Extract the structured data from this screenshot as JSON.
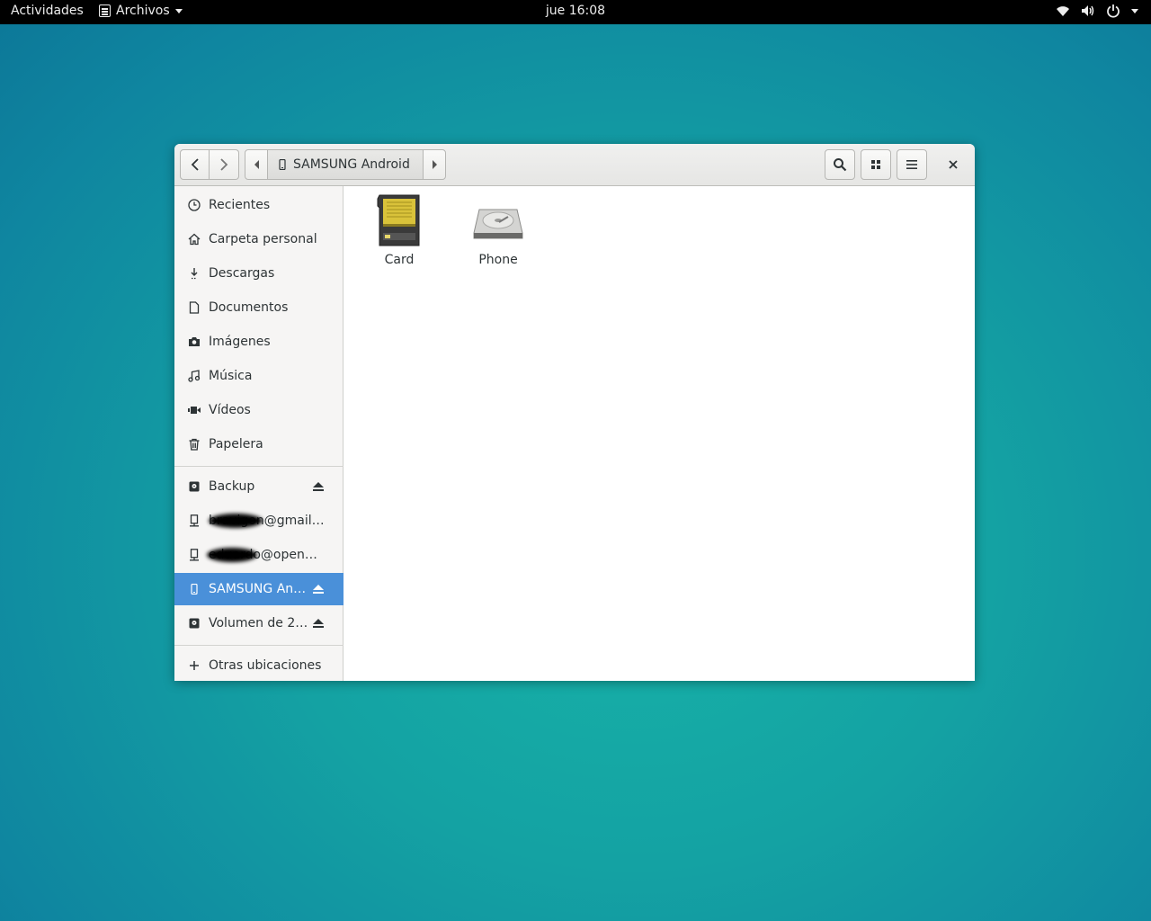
{
  "topbar": {
    "activities": "Actividades",
    "app_name": "Archivos",
    "clock": "jue 16:08"
  },
  "window": {
    "location": "SAMSUNG Android",
    "icons": {
      "back": "go-previous-icon",
      "forward": "go-next-icon",
      "search": "search-icon",
      "view": "grid-view-icon",
      "menu": "hamburger-menu-icon",
      "close": "close-icon"
    }
  },
  "sidebar": {
    "places": [
      {
        "label": "Recientes",
        "icon": "clock-icon"
      },
      {
        "label": "Carpeta personal",
        "icon": "home-icon"
      },
      {
        "label": "Descargas",
        "icon": "download-icon"
      },
      {
        "label": "Documentos",
        "icon": "document-icon"
      },
      {
        "label": "Imágenes",
        "icon": "camera-icon"
      },
      {
        "label": "Música",
        "icon": "music-icon"
      },
      {
        "label": "Vídeos",
        "icon": "video-icon"
      },
      {
        "label": "Papelera",
        "icon": "trash-icon"
      }
    ],
    "devices": [
      {
        "label": "Backup",
        "icon": "drive-icon",
        "eject": true
      },
      {
        "label": "bravigon@gmail.c…",
        "icon": "network-icon",
        "eject": false
      },
      {
        "label": "eduardo@openmail…",
        "icon": "network-icon",
        "eject": false
      },
      {
        "label": "SAMSUNG An…",
        "icon": "phone-icon",
        "eject": true,
        "selected": true
      },
      {
        "label": "Volumen de 2…",
        "icon": "drive-icon",
        "eject": true
      }
    ],
    "other": {
      "label": "Otras ubicaciones",
      "icon": "plus-icon"
    }
  },
  "files": [
    {
      "name": "Card",
      "icon": "sd-card-icon"
    },
    {
      "name": "Phone",
      "icon": "hard-drive-icon"
    }
  ],
  "colors": {
    "accent": "#4a90d9",
    "topbar": "#000000"
  }
}
